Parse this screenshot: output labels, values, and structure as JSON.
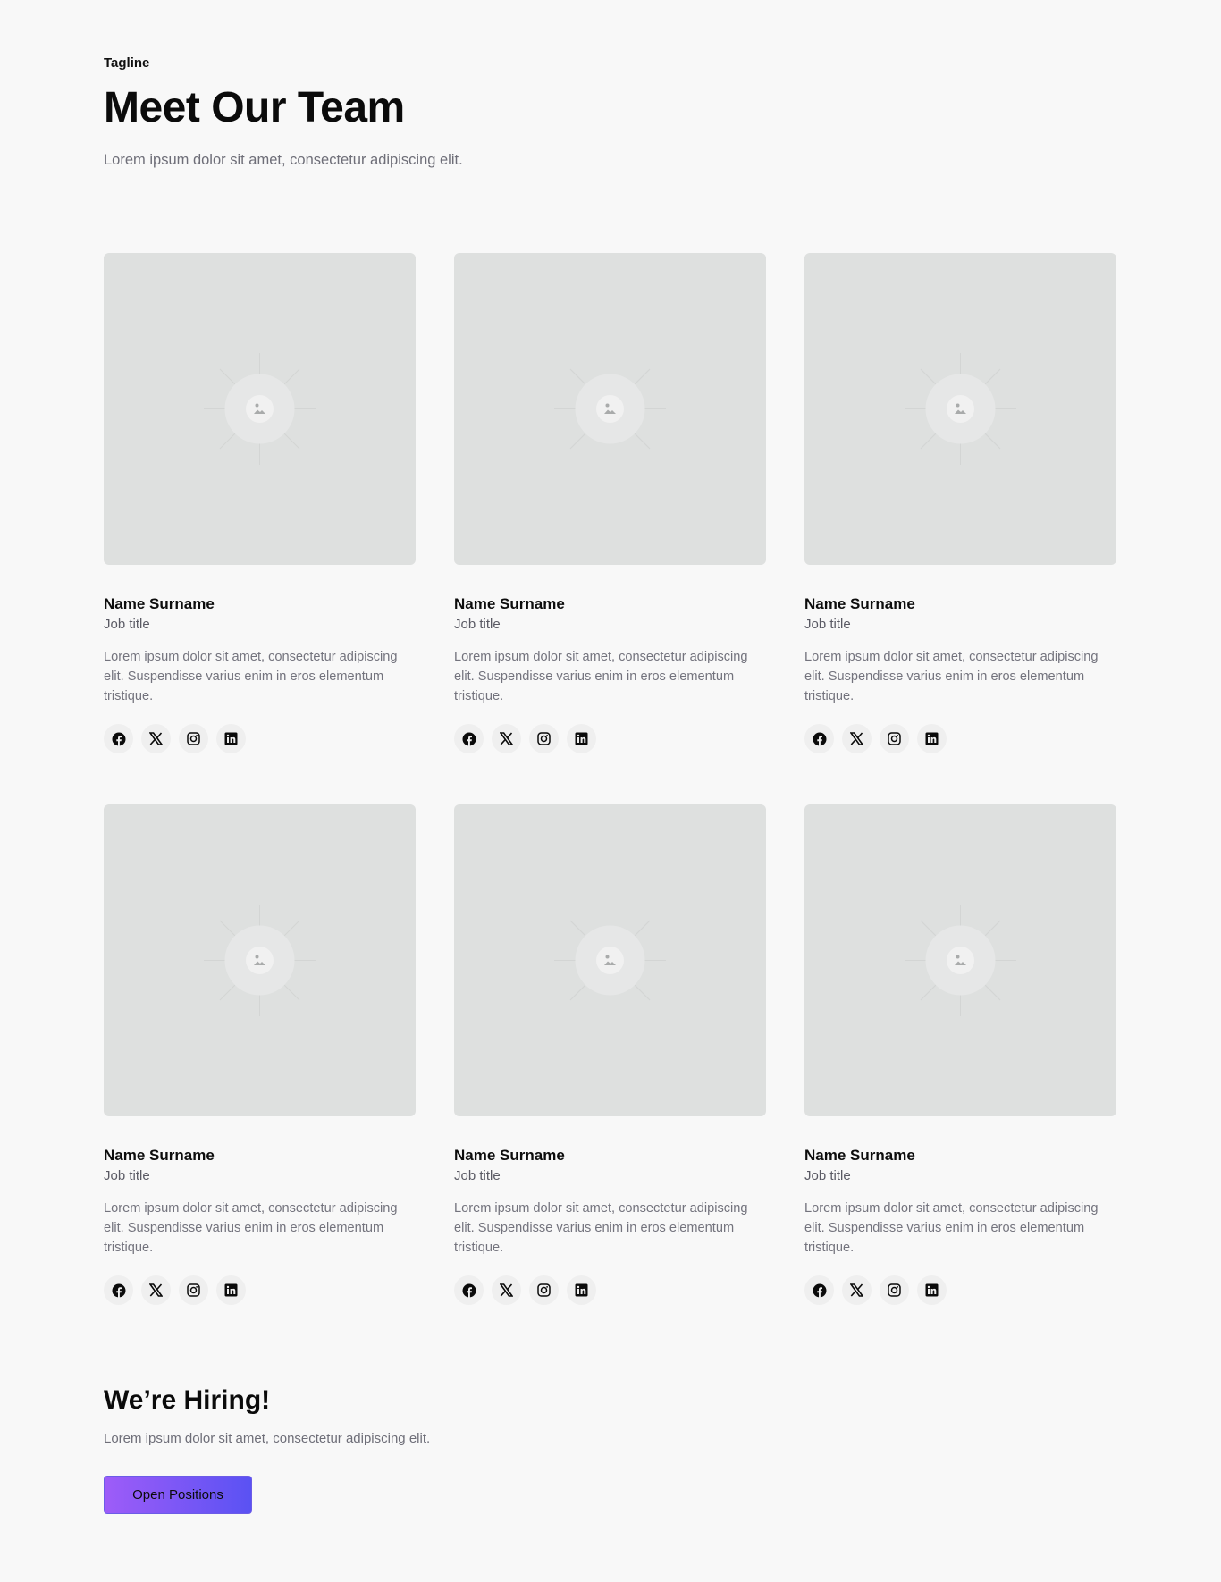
{
  "header": {
    "tagline": "Tagline",
    "title": "Meet Our Team",
    "intro": "Lorem ipsum dolor sit amet, consectetur adipiscing elit."
  },
  "team": [
    {
      "name": "Name Surname",
      "job": "Job title",
      "bio": "Lorem ipsum dolor sit amet, consectetur adipiscing elit. Suspendisse varius enim in eros elementum tristique."
    },
    {
      "name": "Name Surname",
      "job": "Job title",
      "bio": "Lorem ipsum dolor sit amet, consectetur adipiscing elit. Suspendisse varius enim in eros elementum tristique."
    },
    {
      "name": "Name Surname",
      "job": "Job title",
      "bio": "Lorem ipsum dolor sit amet, consectetur adipiscing elit. Suspendisse varius enim in eros elementum tristique."
    },
    {
      "name": "Name Surname",
      "job": "Job title",
      "bio": "Lorem ipsum dolor sit amet, consectetur adipiscing elit. Suspendisse varius enim in eros elementum tristique."
    },
    {
      "name": "Name Surname",
      "job": "Job title",
      "bio": "Lorem ipsum dolor sit amet, consectetur adipiscing elit. Suspendisse varius enim in eros elementum tristique."
    },
    {
      "name": "Name Surname",
      "job": "Job title",
      "bio": "Lorem ipsum dolor sit amet, consectetur adipiscing elit. Suspendisse varius enim in eros elementum tristique."
    }
  ],
  "social_icons": [
    "facebook-icon",
    "x-icon",
    "instagram-icon",
    "linkedin-icon"
  ],
  "hiring": {
    "title": "We’re Hiring!",
    "text": "Lorem ipsum dolor sit amet, consectetur adipiscing elit.",
    "button_label": "Open Positions"
  },
  "colors": {
    "background": "#f8f8f8",
    "placeholder": "#dee0df",
    "button_gradient_start": "#9e5cf8",
    "button_gradient_end": "#5a52f3"
  }
}
